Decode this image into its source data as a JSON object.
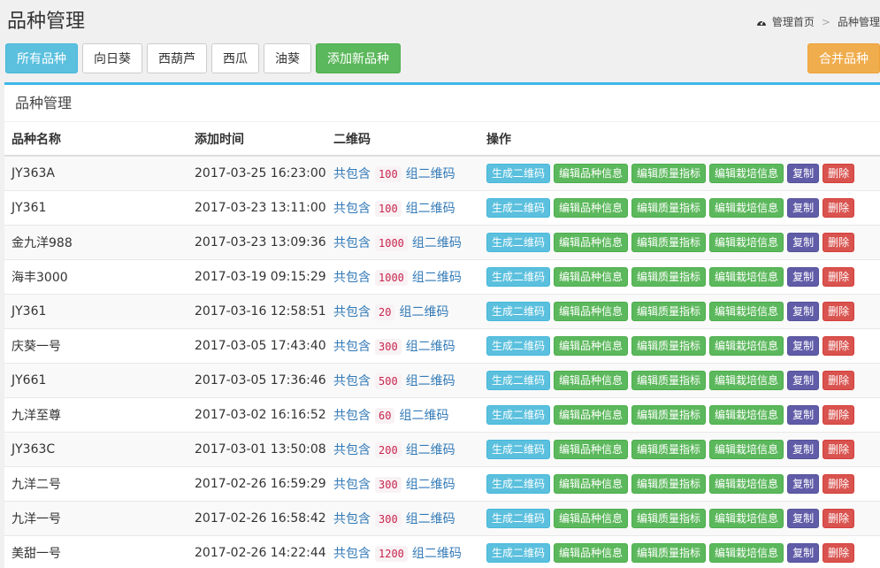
{
  "header": {
    "title": "品种管理"
  },
  "breadcrumb": {
    "icon": "dashboard-icon",
    "home": "管理首页",
    "separator": ">",
    "current": "品种管理"
  },
  "filters": [
    {
      "label": "所有品种",
      "active": true
    },
    {
      "label": "向日葵",
      "active": false
    },
    {
      "label": "西葫芦",
      "active": false
    },
    {
      "label": "西瓜",
      "active": false
    },
    {
      "label": "油葵",
      "active": false
    }
  ],
  "add_label": "添加新品种",
  "merge_label": "合并品种",
  "panel": {
    "title": "品种管理"
  },
  "table": {
    "columns": [
      "品种名称",
      "添加时间",
      "二维码",
      "操作"
    ],
    "qr_prefix": "共包含",
    "qr_suffix": "组二维码",
    "actions": [
      "生成二维码",
      "编辑品种信息",
      "编辑质量指标",
      "编辑栽培信息",
      "复制",
      "删除"
    ],
    "rows": [
      {
        "name": "JY363A",
        "time": "2017-03-25 16:23:00",
        "count": "100"
      },
      {
        "name": "JY361",
        "time": "2017-03-23 13:11:00",
        "count": "100"
      },
      {
        "name": "金九洋988",
        "time": "2017-03-23 13:09:36",
        "count": "1000"
      },
      {
        "name": "海丰3000",
        "time": "2017-03-19 09:15:29",
        "count": "1000"
      },
      {
        "name": "JY361",
        "time": "2017-03-16 12:58:51",
        "count": "20"
      },
      {
        "name": "庆葵一号",
        "time": "2017-03-05 17:43:40",
        "count": "300"
      },
      {
        "name": "JY661",
        "time": "2017-03-05 17:36:46",
        "count": "500"
      },
      {
        "name": "九洋至尊",
        "time": "2017-03-02 16:16:52",
        "count": "60"
      },
      {
        "name": "JY363C",
        "time": "2017-03-01 13:50:08",
        "count": "200"
      },
      {
        "name": "九洋二号",
        "time": "2017-02-26 16:59:29",
        "count": "300"
      },
      {
        "name": "九洋一号",
        "time": "2017-02-26 16:58:42",
        "count": "300"
      },
      {
        "name": "美甜一号",
        "time": "2017-02-26 14:22:44",
        "count": "1200"
      }
    ]
  }
}
